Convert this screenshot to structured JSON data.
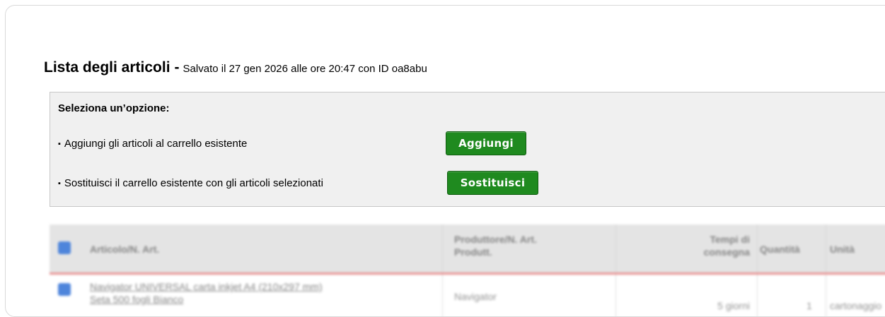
{
  "header": {
    "title": "Lista degli articoli",
    "separator": "-",
    "subtitle": "Salvato il 27 gen 2026 alle ore 20:47 con ID oa8abu"
  },
  "options": {
    "heading": "Seleziona un’opzione:",
    "bullet": "▪",
    "items": [
      {
        "label": "Aggiungi gli articoli al carrello esistente",
        "button": "Aggiungi"
      },
      {
        "label": "Sostituisci il carrello esistente con gli articoli selezionati",
        "button": "Sostituisci"
      }
    ]
  },
  "table": {
    "columns": {
      "article": "Articolo/N. Art.",
      "producer_line1": "Produttore/N. Art.",
      "producer_line2": "Produtt.",
      "delivery_line1": "Tempi di",
      "delivery_line2": "consegna",
      "quantity": "Quantità",
      "unit": "Unità"
    },
    "rows": [
      {
        "article_line1": "Navigator UNIVERSAL carta inkjet A4 (210x297 mm)",
        "article_line2": "Seta 500 fogli Bianco",
        "producer": "Navigator",
        "delivery": "5 giorni",
        "quantity": "1",
        "unit": "cartonaggio"
      }
    ]
  },
  "colors": {
    "button": "#1f8a1f",
    "checkbox": "#3b78d8",
    "header_divider": "#e58585"
  }
}
